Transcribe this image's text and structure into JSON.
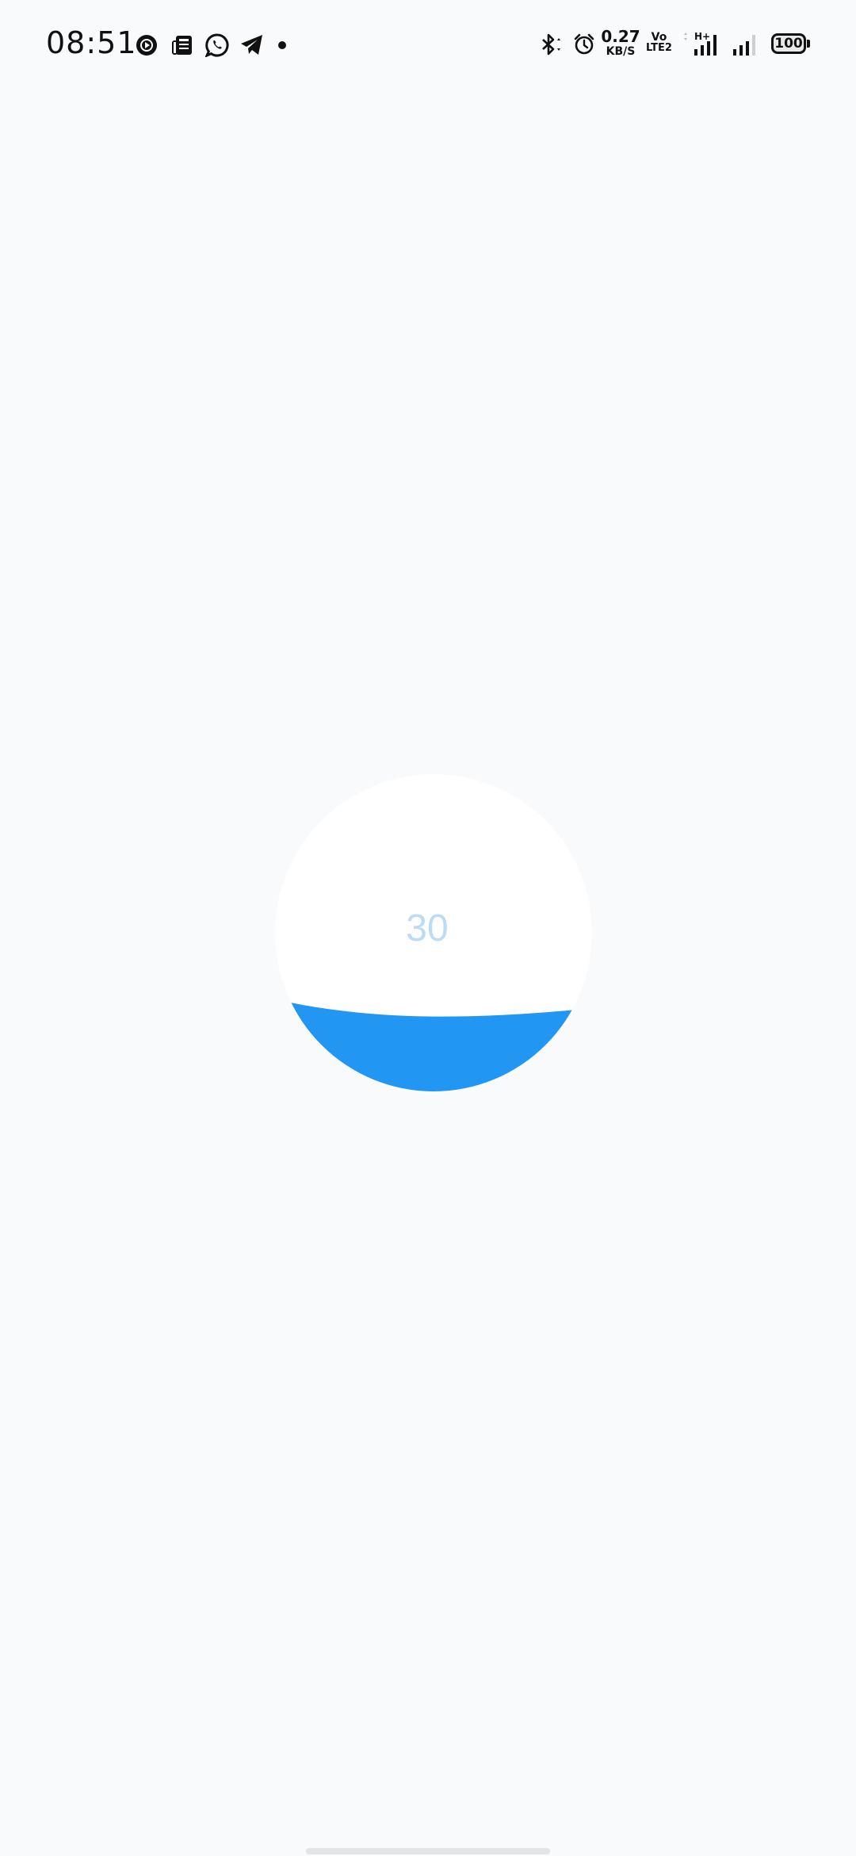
{
  "status_bar": {
    "time": "08:51",
    "left_icons": [
      "music-player-icon",
      "news-icon",
      "whatsapp-icon",
      "telegram-icon",
      "notification-dot-icon"
    ],
    "right_icons": [
      "bluetooth-icon",
      "alarm-icon",
      "volte-icon",
      "signal-h-plus-icon",
      "signal-icon",
      "battery-icon"
    ],
    "net_speed_value": "0.27",
    "net_speed_unit": "KB/S",
    "volte_top": "Vo",
    "volte_bottom": "LTE2",
    "signal_tech": "H+",
    "battery_level": "100"
  },
  "progress": {
    "value": "30",
    "fraction": 0.3,
    "fill_color": "#2196f3",
    "track_color": "#ffffff",
    "text_color": "#bcdcf6"
  }
}
